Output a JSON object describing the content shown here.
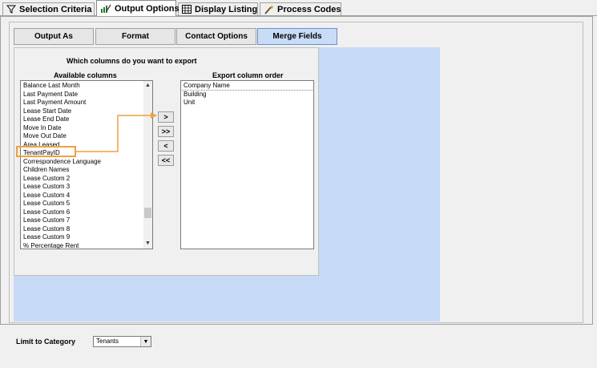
{
  "tabs": [
    {
      "label": "Selection Criteria",
      "icon": "filter-icon"
    },
    {
      "label": "Output Options",
      "icon": "chart-pen-icon",
      "active": true
    },
    {
      "label": "Display Listing",
      "icon": "grid-icon"
    },
    {
      "label": "Process Codes",
      "icon": "wand-icon"
    }
  ],
  "subtabs": [
    {
      "label": "Output As"
    },
    {
      "label": "Format"
    },
    {
      "label": "Contact Options"
    },
    {
      "label": "Merge Fields",
      "active": true
    }
  ],
  "merge": {
    "question": "Which columns do you want to export",
    "available_label": "Available columns",
    "order_label": "Export column order",
    "available": [
      "Balance Last Month",
      "Last Payment Date",
      "Last Payment Amount",
      "Lease Start Date",
      "Lease End Date",
      "Move In Date",
      "Move Out Date",
      "Area Leased",
      "TenantPayID",
      "Correspondence Language",
      "Children Names",
      "Lease Custom 2",
      "Lease Custom 3",
      "Lease Custom 4",
      "Lease Custom 5",
      "Lease Custom 6",
      "Lease Custom 7",
      "Lease Custom 8",
      "Lease Custom 9",
      "% Percentage Rent"
    ],
    "order": [
      "Company Name",
      "Building",
      "Unit"
    ],
    "buttons": {
      "add": ">",
      "add_all": ">>",
      "remove": "<",
      "remove_all": "<<"
    }
  },
  "limit": {
    "label": "Limit to Category",
    "value": "Tenants"
  },
  "colors": {
    "accent": "#c9dcf7",
    "blue_area": "#c6daf6",
    "callout": "#f0a040"
  }
}
